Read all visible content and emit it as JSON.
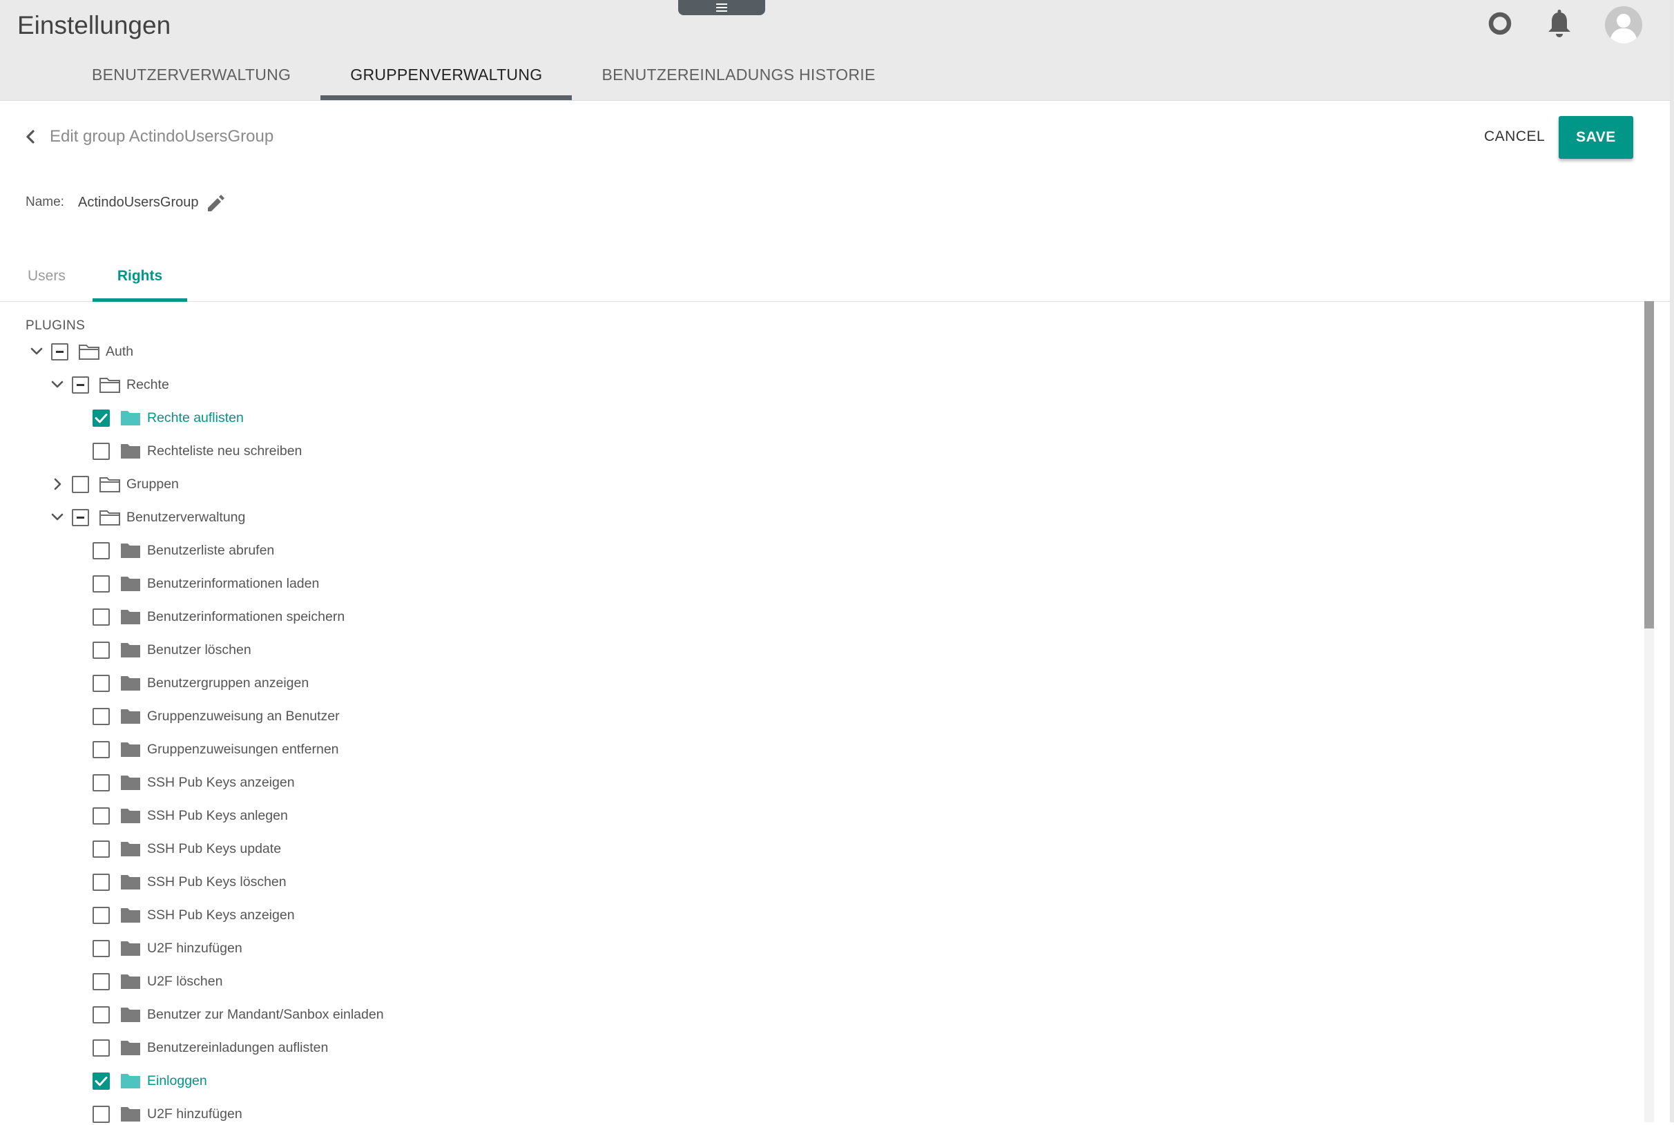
{
  "header": {
    "app_title": "Einstellungen",
    "icons": [
      "help-circle-icon",
      "notification-bell-icon",
      "user-avatar-icon"
    ],
    "tabs": [
      {
        "label": "BENUTZERVERWALTUNG",
        "active": false
      },
      {
        "label": "GRUPPENVERWALTUNG",
        "active": true
      },
      {
        "label": "BENUTZEREINLADUNGS HISTORIE",
        "active": false
      }
    ]
  },
  "edit": {
    "title": "Edit group ActindoUsersGroup",
    "cancel_label": "CANCEL",
    "save_label": "SAVE",
    "name_label": "Name:",
    "name_value": "ActindoUsersGroup"
  },
  "subtabs": {
    "users": "Users",
    "rights": "Rights",
    "active": "Rights"
  },
  "tree": {
    "section": "PLUGINS",
    "nodes": [
      {
        "level": 0,
        "label": "Auth",
        "chevron": "down",
        "state": "indeterminate",
        "folder": "outline",
        "selected": false
      },
      {
        "level": 1,
        "label": "Rechte",
        "chevron": "down",
        "state": "indeterminate",
        "folder": "outline",
        "selected": false
      },
      {
        "level": 2,
        "label": "Rechte auflisten",
        "chevron": "none",
        "state": "checked",
        "folder": "filled",
        "selected": true
      },
      {
        "level": 2,
        "label": "Rechteliste neu schreiben",
        "chevron": "none",
        "state": "unchecked",
        "folder": "filled",
        "selected": false
      },
      {
        "level": 1,
        "label": "Gruppen",
        "chevron": "right",
        "state": "unchecked",
        "folder": "outline",
        "selected": false
      },
      {
        "level": 1,
        "label": "Benutzerverwaltung",
        "chevron": "down",
        "state": "indeterminate",
        "folder": "outline",
        "selected": false
      },
      {
        "level": 2,
        "label": "Benutzerliste abrufen",
        "chevron": "none",
        "state": "unchecked",
        "folder": "filled",
        "selected": false
      },
      {
        "level": 2,
        "label": "Benutzerinformationen laden",
        "chevron": "none",
        "state": "unchecked",
        "folder": "filled",
        "selected": false
      },
      {
        "level": 2,
        "label": "Benutzerinformationen speichern",
        "chevron": "none",
        "state": "unchecked",
        "folder": "filled",
        "selected": false
      },
      {
        "level": 2,
        "label": "Benutzer löschen",
        "chevron": "none",
        "state": "unchecked",
        "folder": "filled",
        "selected": false
      },
      {
        "level": 2,
        "label": "Benutzergruppen anzeigen",
        "chevron": "none",
        "state": "unchecked",
        "folder": "filled",
        "selected": false
      },
      {
        "level": 2,
        "label": "Gruppenzuweisung an Benutzer",
        "chevron": "none",
        "state": "unchecked",
        "folder": "filled",
        "selected": false
      },
      {
        "level": 2,
        "label": "Gruppenzuweisungen entfernen",
        "chevron": "none",
        "state": "unchecked",
        "folder": "filled",
        "selected": false
      },
      {
        "level": 2,
        "label": "SSH Pub Keys anzeigen",
        "chevron": "none",
        "state": "unchecked",
        "folder": "filled",
        "selected": false
      },
      {
        "level": 2,
        "label": "SSH Pub Keys anlegen",
        "chevron": "none",
        "state": "unchecked",
        "folder": "filled",
        "selected": false
      },
      {
        "level": 2,
        "label": "SSH Pub Keys update",
        "chevron": "none",
        "state": "unchecked",
        "folder": "filled",
        "selected": false
      },
      {
        "level": 2,
        "label": "SSH Pub Keys löschen",
        "chevron": "none",
        "state": "unchecked",
        "folder": "filled",
        "selected": false
      },
      {
        "level": 2,
        "label": "SSH Pub Keys anzeigen",
        "chevron": "none",
        "state": "unchecked",
        "folder": "filled",
        "selected": false
      },
      {
        "level": 2,
        "label": "U2F hinzufügen",
        "chevron": "none",
        "state": "unchecked",
        "folder": "filled",
        "selected": false
      },
      {
        "level": 2,
        "label": "U2F löschen",
        "chevron": "none",
        "state": "unchecked",
        "folder": "filled",
        "selected": false
      },
      {
        "level": 2,
        "label": "Benutzer zur Mandant/Sanbox einladen",
        "chevron": "none",
        "state": "unchecked",
        "folder": "filled",
        "selected": false
      },
      {
        "level": 2,
        "label": "Benutzereinladungen auflisten",
        "chevron": "none",
        "state": "unchecked",
        "folder": "filled",
        "selected": false
      },
      {
        "level": 2,
        "label": "Einloggen",
        "chevron": "none",
        "state": "checked",
        "folder": "filled",
        "selected": true
      },
      {
        "level": 2,
        "label": "U2F hinzufügen",
        "chevron": "none",
        "state": "unchecked",
        "folder": "filled",
        "selected": false
      }
    ]
  },
  "colors": {
    "accent": "#009688",
    "header_bg": "#eaeaea",
    "tab_indicator": "#5b6267",
    "folder_gray": "#7b7b7b",
    "folder_selected": "#4fc3c0"
  }
}
